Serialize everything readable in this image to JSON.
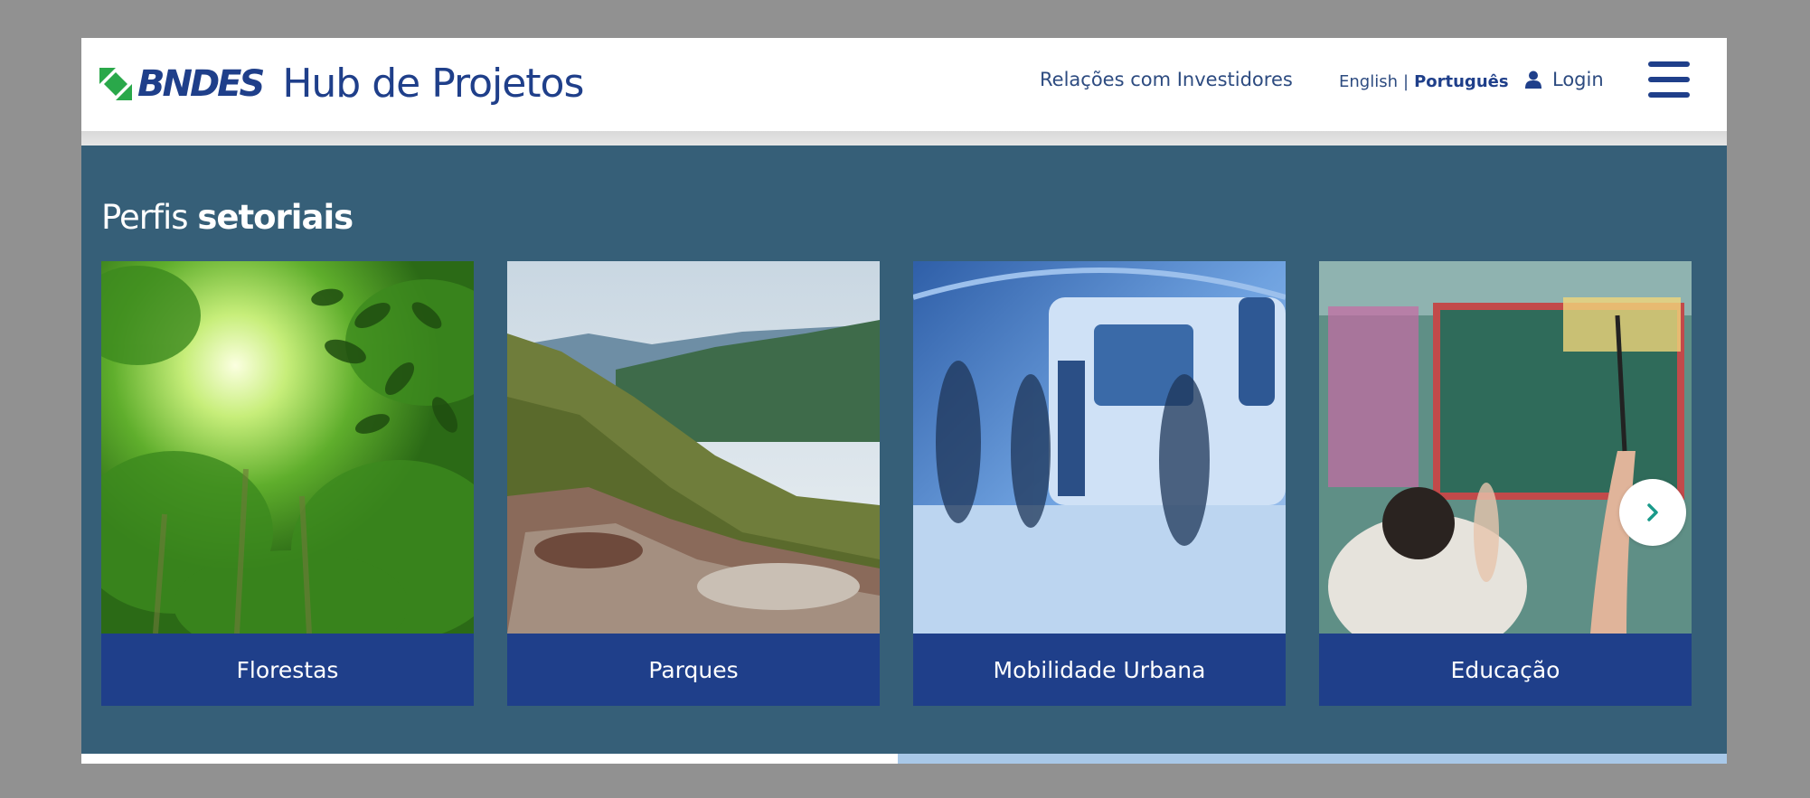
{
  "header": {
    "brand": "BNDES",
    "site_name": "Hub de Projetos",
    "investor_relations": "Relações com Investidores",
    "lang_en": "English",
    "lang_sep": "|",
    "lang_pt": "Português",
    "login_label": "Login",
    "login_icon": "user-icon",
    "menu_icon": "hamburger-menu-icon"
  },
  "section": {
    "title_light": "Perfis",
    "title_bold": "setoriais",
    "cards": [
      {
        "label": "Florestas",
        "image": "forest-canopy-photo"
      },
      {
        "label": "Parques",
        "image": "mountain-park-photo"
      },
      {
        "label": "Mobilidade Urbana",
        "image": "metro-station-photo"
      },
      {
        "label": "Educação",
        "image": "classroom-photo"
      }
    ],
    "next_icon": "chevron-right-icon"
  },
  "colors": {
    "brand_blue": "#1f3f8a",
    "section_bg": "#365f78",
    "accent_teal": "#1a9a8a",
    "progress_rest": "#a8c8e8"
  }
}
